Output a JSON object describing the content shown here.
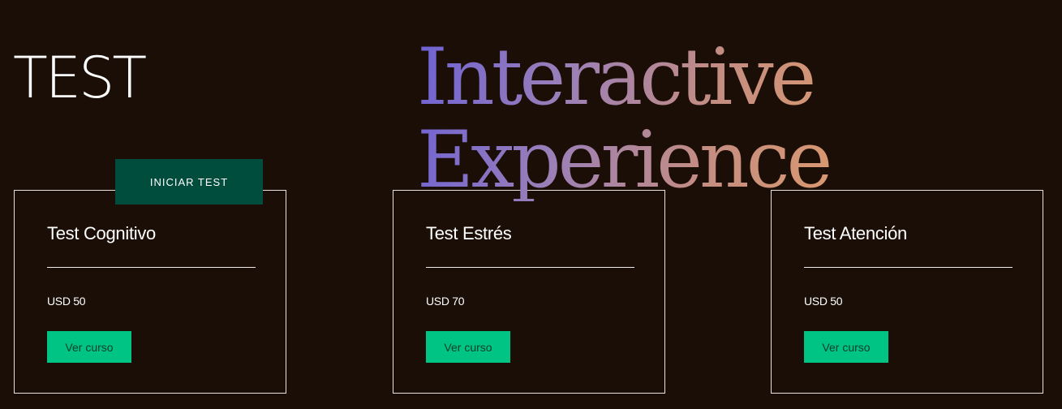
{
  "page": {
    "title": "TEST",
    "hero_line_1": "Interactive",
    "hero_line_2": "Experience",
    "start_button_label": "INICIAR TEST"
  },
  "cards": [
    {
      "title": "Test Cognitivo",
      "price": "USD 50",
      "button_label": "Ver curso"
    },
    {
      "title": "Test Estrés",
      "price": "USD 70",
      "button_label": "Ver curso"
    },
    {
      "title": "Test Atención",
      "price": "USD 50",
      "button_label": "Ver curso"
    }
  ],
  "colors": {
    "background": "#1b0e06",
    "card_border": "#e8e2de",
    "start_button": "#004d3e",
    "course_button": "#00c483",
    "hero_gradient_start": "#6e62d4",
    "hero_gradient_end": "#d99870"
  }
}
